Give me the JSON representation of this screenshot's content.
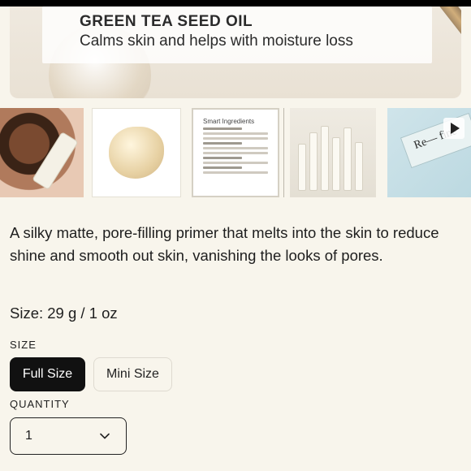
{
  "hero": {
    "title": "GREEN TEA SEED OIL",
    "subtitle": "Calms skin and helps with moisture loss"
  },
  "thumbnails": [
    {
      "name": "model-with-tube"
    },
    {
      "name": "primer-swatch"
    },
    {
      "name": "smart-ingredients-card",
      "title": "Smart Ingredients"
    },
    {
      "name": "product-lineup"
    },
    {
      "name": "refine-video",
      "text": "Re— fine",
      "icon": "play-icon"
    }
  ],
  "description": "A silky matte, pore-filling primer that melts into the skin to reduce shine and smooth out skin, vanishing the looks of pores.",
  "size_info": "Size: 29 g / 1 oz",
  "size": {
    "label": "SIZE",
    "options": [
      "Full Size",
      "Mini Size"
    ],
    "selected": "Full Size"
  },
  "quantity": {
    "label": "QUANTITY",
    "value": "1",
    "icon": "chevron-down-icon"
  },
  "colors": {
    "background": "#f8f5ec",
    "selected_button": "#111111",
    "text": "#1e1e1e"
  }
}
